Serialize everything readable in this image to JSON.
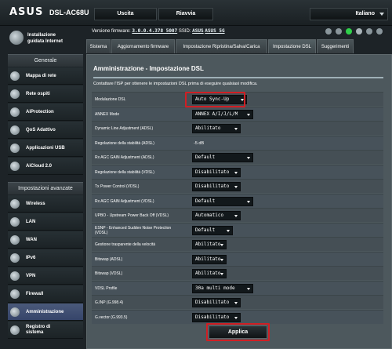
{
  "header": {
    "logo": "ASUS",
    "model": "DSL-AC68U",
    "exit_label": "Uscita",
    "reboot_label": "Riavvia",
    "language": "Italiano"
  },
  "firmware": {
    "label": "Versione firmware:",
    "version": "3.0.0.4.378_5007",
    "ssid_label": "SSID:",
    "ssid1": "ASUS",
    "ssid2": "ASUS_5G"
  },
  "sidebar": {
    "quick_setup": "Installazione\nguidata Internet",
    "general_header": "Generale",
    "general_items": [
      "Mappa di rete",
      "Rete ospiti",
      "AiProtection",
      "QoS Adattivo",
      "Applicazioni USB",
      "AiCloud 2.0"
    ],
    "advanced_header": "Impostazioni avanzate",
    "advanced_items": [
      "Wireless",
      "LAN",
      "WAN",
      "IPv6",
      "VPN",
      "Firewall",
      "Amministrazione",
      "Registro di\nsistema"
    ]
  },
  "tabs": [
    "Sistema",
    "Aggiornamento firmware",
    "Impostazione Ripristina/Salva/Carica",
    "Impostazione DSL",
    "Suggerimenti"
  ],
  "panel": {
    "title": "Amministrazione - Impostazione DSL",
    "description": "Contattare l'ISP per ottenere le impostazioni DSL prima di eseguire qualsiasi modifica."
  },
  "settings": [
    {
      "label": "Modulazione DSL",
      "value": "Auto Sync-Up",
      "type": "select"
    },
    {
      "label": "ANNEX Mode",
      "value": "ANNEX A/I/J/L/M",
      "type": "select"
    },
    {
      "label": "Dynamic Line Adjustment (ADSL)",
      "value": "Abilitato",
      "type": "select"
    },
    {
      "label": "Regolazione della stabilità (ADSL)",
      "value": "-5 dB",
      "type": "text"
    },
    {
      "label": "Rx AGC GAIN Adjustment (ADSL)",
      "value": "Default",
      "type": "select"
    },
    {
      "label": "Regolazione della stabilità (VDSL)",
      "value": "Disabilitato",
      "type": "select"
    },
    {
      "label": "Tx Power Control (VDSL)",
      "value": "Disabilitato",
      "type": "select"
    },
    {
      "label": "Rx AGC GAIN Adjustment (VDSL)",
      "value": "Default",
      "type": "select"
    },
    {
      "label": "UPBO - Upstream Power Back Off (VDSL)",
      "value": "Automatico",
      "type": "select"
    },
    {
      "label": "ESNP - Enhanced Sudden Noise Protection\n(VDSL)",
      "value": "Default",
      "type": "select"
    },
    {
      "label": "Gestione trasparente della velocità",
      "value": "Abilitato",
      "type": "select"
    },
    {
      "label": "Bitswap (ADSL)",
      "value": "Abilitato",
      "type": "select"
    },
    {
      "label": "Bitswap (VDSL)",
      "value": "Abilitato",
      "type": "select"
    },
    {
      "label": "VDSL Profile",
      "value": "30a multi mode",
      "type": "select"
    },
    {
      "label": "G.INP (G.998.4)",
      "value": "Disabilitato",
      "type": "select"
    },
    {
      "label": "G.vector (G.993.5)",
      "value": "Disabilitato",
      "type": "select"
    }
  ],
  "apply_label": "Applica",
  "colors": {
    "highlight": "#d01f24",
    "panel_bg": "#4d585d",
    "background": "#1d2327"
  },
  "icons": {
    "quick_setup": "globe-icon",
    "language_caret": "chevron-down-icon"
  }
}
